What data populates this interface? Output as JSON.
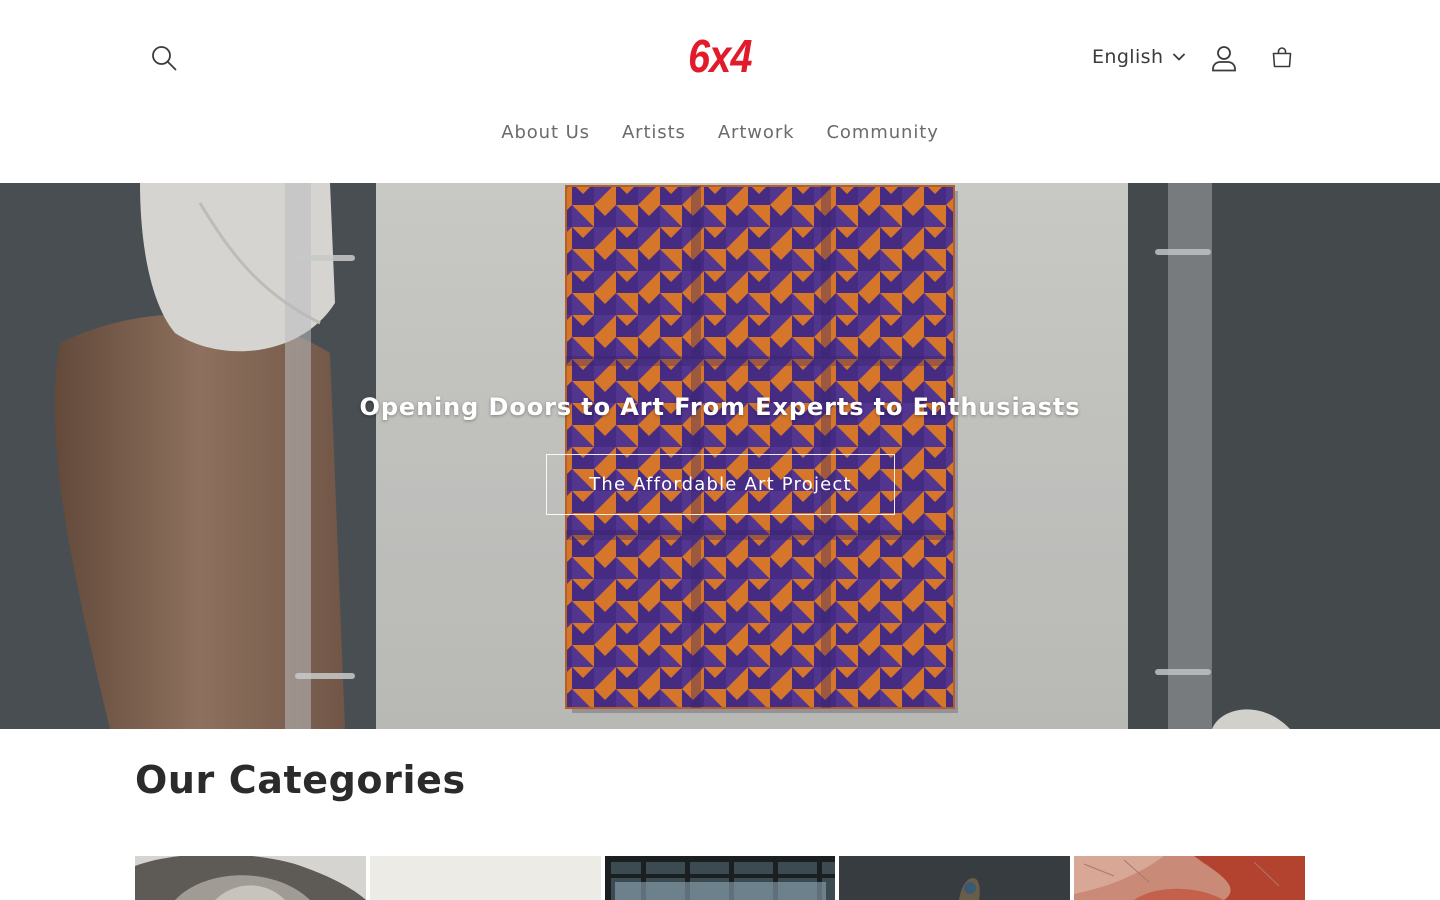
{
  "header": {
    "logo_text": "6x4",
    "brand_color": "#e21b2b",
    "search_icon": "search-icon",
    "language": {
      "selected": "English",
      "icon": "chevron-down-icon"
    },
    "account_icon": "user-icon",
    "cart_icon": "cart-icon"
  },
  "nav": {
    "items": [
      {
        "label": "About Us"
      },
      {
        "label": "Artists"
      },
      {
        "label": "Artwork"
      },
      {
        "label": "Community"
      }
    ]
  },
  "hero": {
    "heading": "Opening Doors to Art From Experts to Enthusiasts",
    "button_label": "The Affordable Art Project",
    "artwork_colors": [
      "#e8802e",
      "#4b2f8e"
    ]
  },
  "categories": {
    "title": "Our Categories",
    "cards": [
      {
        "image": "portrait-photo"
      },
      {
        "image": "paper-texture"
      },
      {
        "image": "gallery-interior"
      },
      {
        "image": "sculpture-photo"
      },
      {
        "image": "textured-painting"
      }
    ]
  }
}
